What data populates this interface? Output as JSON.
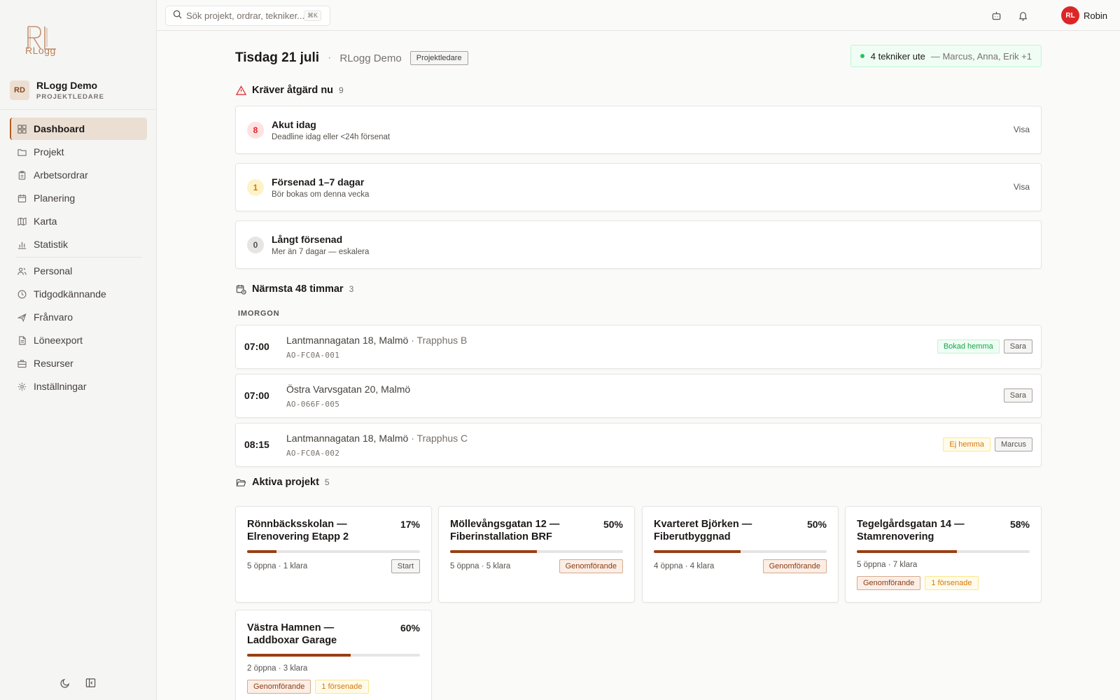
{
  "sidebar": {
    "logo_text": "RLogg",
    "org_avatar": "RD",
    "org_name": "RLogg Demo",
    "org_role": "PROJEKTLEDARE",
    "items": [
      {
        "label": "Dashboard",
        "icon": "dashboard-icon"
      },
      {
        "label": "Projekt",
        "icon": "folder-icon"
      },
      {
        "label": "Arbetsordrar",
        "icon": "clipboard-icon"
      },
      {
        "label": "Planering",
        "icon": "calendar-icon"
      },
      {
        "label": "Karta",
        "icon": "map-icon"
      },
      {
        "label": "Statistik",
        "icon": "bar-chart-icon"
      },
      {
        "label": "Personal",
        "icon": "users-icon"
      },
      {
        "label": "Tidgodkännande",
        "icon": "clock-icon"
      },
      {
        "label": "Frånvaro",
        "icon": "plane-icon"
      },
      {
        "label": "Löneexport",
        "icon": "file-icon"
      },
      {
        "label": "Resurser",
        "icon": "briefcase-icon"
      },
      {
        "label": "Inställningar",
        "icon": "gear-icon"
      }
    ]
  },
  "topbar": {
    "search_placeholder": "Sök projekt, ordrar, tekniker...",
    "search_shortcut": "⌘K",
    "user_initials": "RL",
    "user_name": "Robin"
  },
  "header": {
    "date": "Tisdag 21 juli",
    "separator": "·",
    "org": "RLogg Demo",
    "role_badge": "Projektledare",
    "tech_count": "4 tekniker ute",
    "tech_names": "— Marcus, Anna, Erik +1"
  },
  "alerts": {
    "title": "Kräver åtgärd nu",
    "count": "9",
    "items": [
      {
        "num": "8",
        "title": "Akut idag",
        "sub": "Deadline idag eller <24h försenat",
        "action": "Visa"
      },
      {
        "num": "1",
        "title": "Försenad 1–7 dagar",
        "sub": "Bör bokas om denna vecka",
        "action": "Visa"
      },
      {
        "num": "0",
        "title": "Långt försenad",
        "sub": "Mer än 7 dagar — eskalera",
        "action": ""
      }
    ]
  },
  "upcoming": {
    "title": "Närmsta 48 timmar",
    "count": "3",
    "day_label": "IMORGON",
    "jobs": [
      {
        "time": "07:00",
        "address": "Lantmannagatan 18, Malmö",
        "sub": " · Trapphus B",
        "code": "AO-FC0A-001",
        "tags": [
          "Bokad hemma",
          "Sara"
        ]
      },
      {
        "time": "07:00",
        "address": "Östra Varvsgatan 20, Malmö",
        "sub": "",
        "code": "AO-066F-005",
        "tags": [
          "Sara"
        ]
      },
      {
        "time": "08:15",
        "address": "Lantmannagatan 18, Malmö",
        "sub": " · Trapphus C",
        "code": "AO-FC0A-002",
        "tags": [
          "Ej hemma",
          "Marcus"
        ]
      }
    ]
  },
  "projects": {
    "title": "Aktiva projekt",
    "count": "5",
    "items": [
      {
        "title": "Rönnbäcksskolan — Elrenovering Etapp 2",
        "pct": "17%",
        "progress": 0.17,
        "stats": "5 öppna · 1 klara",
        "tags": [
          "Start"
        ]
      },
      {
        "title": "Möllevångsgatan 12 — Fiberinstallation BRF",
        "pct": "50%",
        "progress": 0.5,
        "stats": "5 öppna · 5 klara",
        "tags": [
          "Genomförande"
        ]
      },
      {
        "title": "Kvarteret Björken — Fiberutbyggnad",
        "pct": "50%",
        "progress": 0.5,
        "stats": "4 öppna · 4 klara",
        "tags": [
          "Genomförande"
        ]
      },
      {
        "title": "Tegelgårdsgatan 14 — Stamrenovering",
        "pct": "58%",
        "progress": 0.58,
        "stats": "5 öppna · 7 klara",
        "tags": [
          "Genomförande",
          "1 försenade"
        ]
      },
      {
        "title": "Västra Hamnen — Laddboxar Garage",
        "pct": "60%",
        "progress": 0.6,
        "stats": "2 öppna · 3 klara",
        "tags": [
          "Genomförande",
          "1 försenade"
        ]
      }
    ]
  }
}
